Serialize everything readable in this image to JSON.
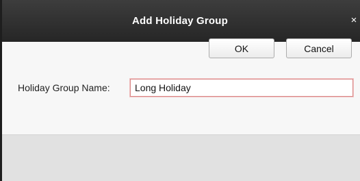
{
  "dialog": {
    "title": "Add Holiday Group",
    "close_glyph": "×",
    "close_icon": "close-icon"
  },
  "form": {
    "holiday_group_name_label": "Holiday Group Name:",
    "holiday_group_name_value": "Long Holiday"
  },
  "buttons": {
    "ok_label": "OK",
    "cancel_label": "Cancel"
  },
  "colors": {
    "titlebar": "#2e2e2e",
    "input_focus_border": "#d98a8a"
  }
}
